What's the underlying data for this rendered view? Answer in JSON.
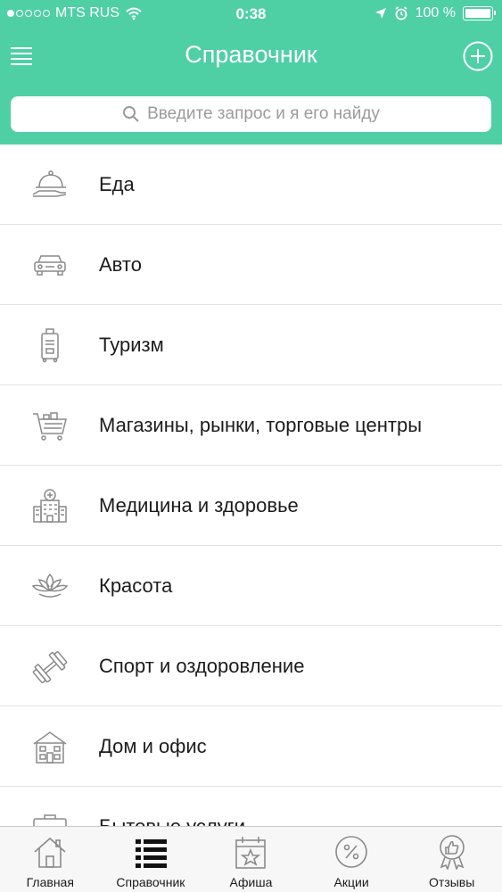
{
  "status_bar": {
    "carrier": "MTS RUS",
    "time": "0:38",
    "battery": "100 %"
  },
  "nav": {
    "title": "Справочник"
  },
  "search": {
    "placeholder": "Введите запрос и я его найду"
  },
  "categories": [
    {
      "label": "Еда",
      "icon": "food-cloche-icon"
    },
    {
      "label": "Авто",
      "icon": "car-icon"
    },
    {
      "label": "Туризм",
      "icon": "suitcase-icon"
    },
    {
      "label": "Магазины, рынки, торговые центры",
      "icon": "shopping-cart-icon"
    },
    {
      "label": "Медицина и здоровье",
      "icon": "hospital-icon"
    },
    {
      "label": "Красота",
      "icon": "lotus-icon"
    },
    {
      "label": "Спорт и оздоровление",
      "icon": "dumbbell-icon"
    },
    {
      "label": "Дом и офис",
      "icon": "house-icon"
    },
    {
      "label": "Бытовые услуги",
      "icon": "toolbox-icon"
    }
  ],
  "tabbar": {
    "tabs": [
      {
        "label": "Главная",
        "icon": "home-icon"
      },
      {
        "label": "Справочник",
        "icon": "list-icon",
        "active": true
      },
      {
        "label": "Афиша",
        "icon": "calendar-star-icon"
      },
      {
        "label": "Акции",
        "icon": "percent-icon"
      },
      {
        "label": "Отзывы",
        "icon": "thumbs-up-badge-icon"
      }
    ]
  },
  "colors": {
    "header": "#4fcfa4",
    "icon_gray": "#8a8a8a"
  }
}
